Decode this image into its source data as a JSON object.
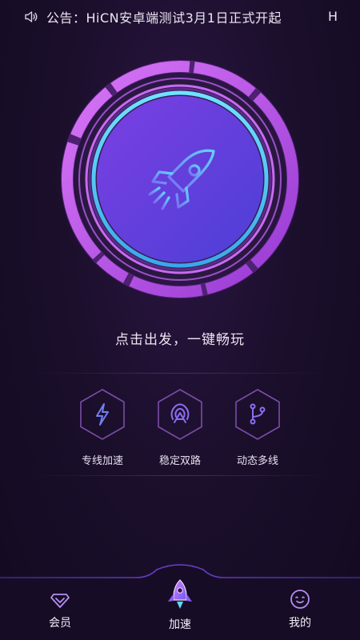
{
  "notice": {
    "text": "公告：HiCN安卓端测试3月1日正式开起",
    "overflow_char": "H",
    "icon": "speaker-icon"
  },
  "main": {
    "action_icon": "rocket-icon",
    "slogan": "点击出发，一键畅玩"
  },
  "features": [
    {
      "label": "专线加速",
      "icon": "lightning-icon"
    },
    {
      "label": "稳定双路",
      "icon": "signal-tower-icon"
    },
    {
      "label": "动态多线",
      "icon": "branch-icon"
    }
  ],
  "tabs": [
    {
      "label": "会员",
      "icon": "diamond-icon"
    },
    {
      "label": "加速",
      "icon": "rocket-icon",
      "active": true
    },
    {
      "label": "我的",
      "icon": "smiley-icon"
    }
  ],
  "colors": {
    "background": "#1b0f2c",
    "accent_purple": "#c14cf0",
    "accent_cyan": "#4fc9ff",
    "core_blue": "#5b3fd6"
  }
}
